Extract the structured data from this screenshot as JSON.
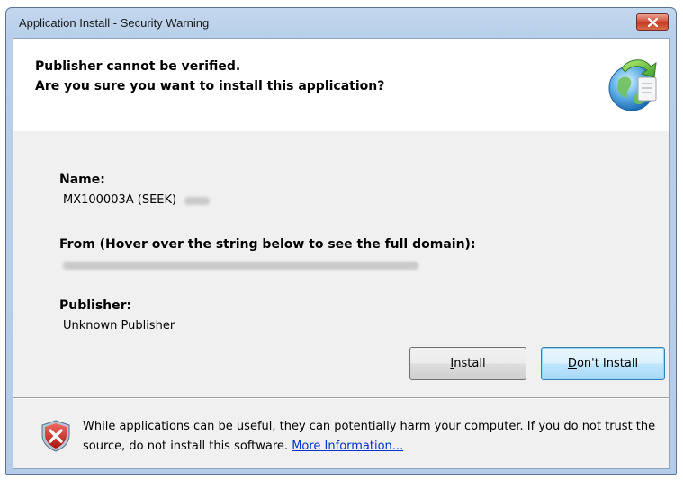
{
  "window": {
    "title": "Application Install - Security Warning"
  },
  "header": {
    "line1": "Publisher cannot be verified.",
    "line2": "Are you sure you want to install this application?"
  },
  "fields": {
    "name_label": "Name:",
    "name_value": "MX100003A (SEEK)",
    "from_label": "From (Hover over the string below to see the full domain):",
    "publisher_label": "Publisher:",
    "publisher_value": "Unknown Publisher"
  },
  "buttons": {
    "install_prefix": "",
    "install_accel": "I",
    "install_rest": "nstall",
    "dont_prefix": "",
    "dont_accel": "D",
    "dont_rest": "on't Install"
  },
  "footer": {
    "warning_text": "While applications can be useful, they can potentially harm your computer. If you do not trust the source, do not install this software. ",
    "more_info_link": "More Information..."
  },
  "icons": {
    "close": "close-icon",
    "app": "globe-install-icon",
    "shield": "shield-warning-icon"
  },
  "colors": {
    "link": "#0033cc",
    "shield_red": "#c8201e",
    "default_button": "#3c7fb1"
  }
}
